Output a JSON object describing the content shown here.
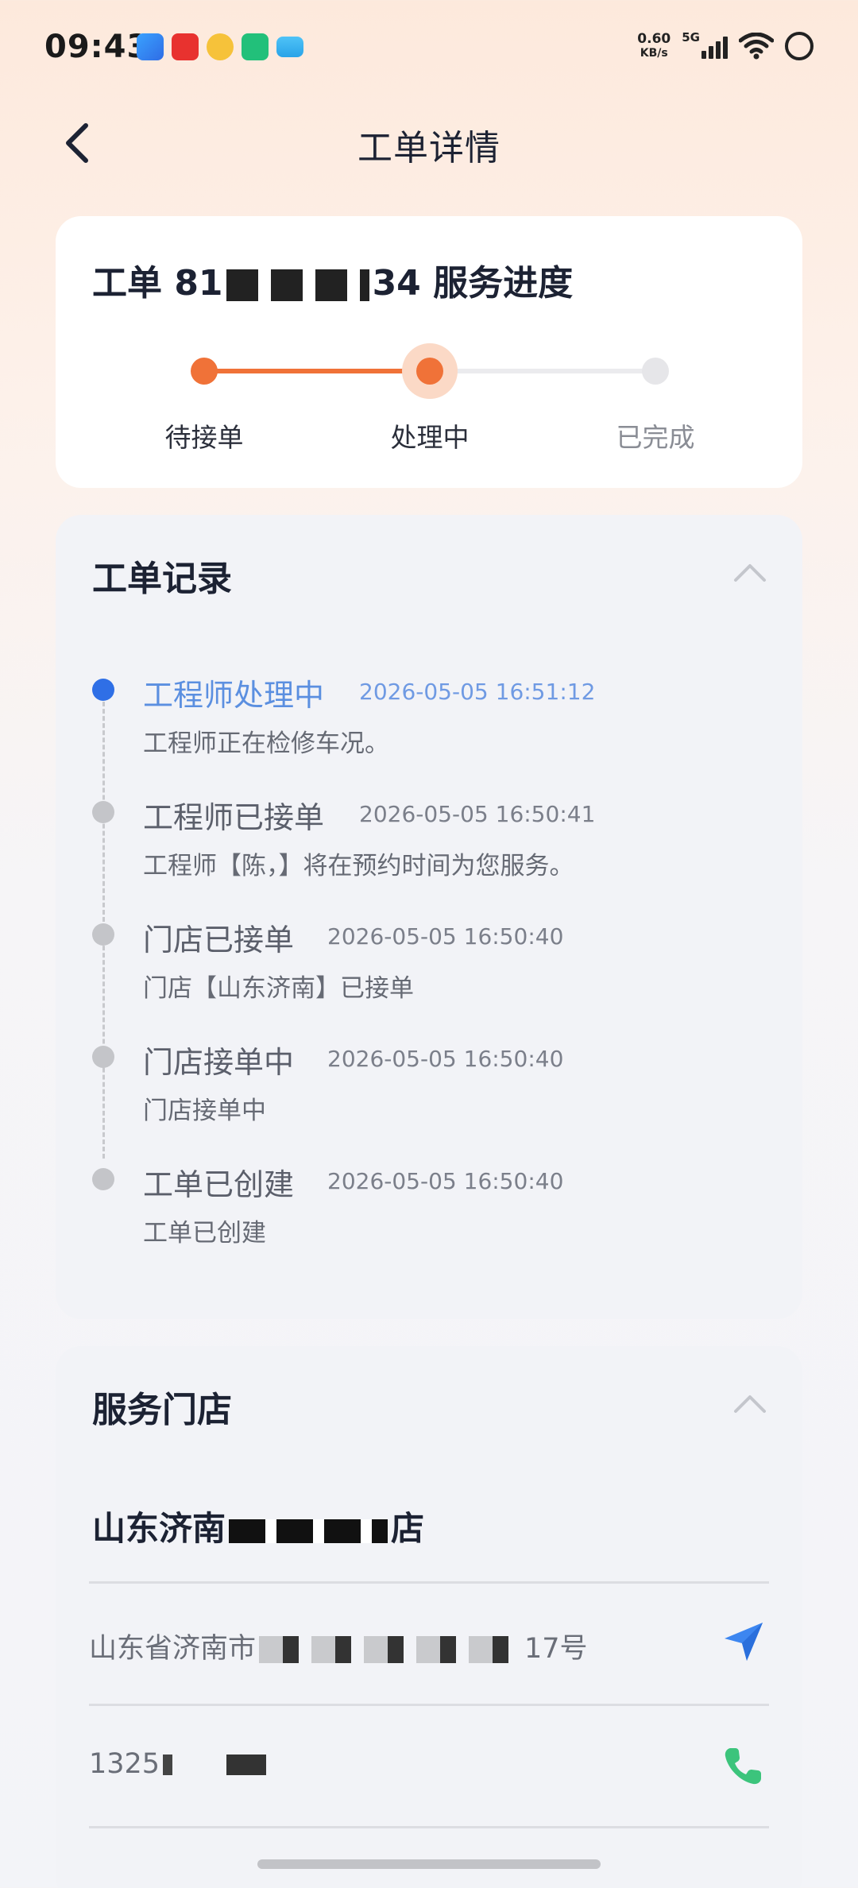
{
  "status_bar": {
    "time": "09:43",
    "net_speed_value": "0.60",
    "net_speed_unit": "KB/s",
    "network_type": "5G"
  },
  "header": {
    "title": "工单详情"
  },
  "progress": {
    "title_prefix": "工单 81",
    "title_suffix": "34 服务进度",
    "steps": [
      {
        "label": "待接单",
        "state": "done"
      },
      {
        "label": "处理中",
        "state": "current"
      },
      {
        "label": "已完成",
        "state": "pending"
      }
    ],
    "accent_color": "#f07238"
  },
  "records": {
    "title": "工单记录",
    "items": [
      {
        "title": "工程师处理中",
        "time": "2026-05-05 16:51:12",
        "desc": "工程师正在检修车况。",
        "active": true
      },
      {
        "title": "工程师已接单",
        "time": "2026-05-05 16:50:41",
        "desc": "工程师【陈，】将在预约时间为您服务。",
        "active": false
      },
      {
        "title": "门店已接单",
        "time": "2026-05-05 16:50:40",
        "desc": "门店【山东济南】已接单",
        "active": false
      },
      {
        "title": "门店接单中",
        "time": "2026-05-05 16:50:40",
        "desc": "门店接单中",
        "active": false
      },
      {
        "title": "工单已创建",
        "time": "2026-05-05 16:50:40",
        "desc": "工单已创建",
        "active": false
      }
    ],
    "active_color": "#2f6fe6"
  },
  "store": {
    "title": "服务门店",
    "name_prefix": "山东济南",
    "name_suffix": "店",
    "address_prefix": "山东省济南市",
    "address_suffix": "17号",
    "phone_prefix": "1325"
  }
}
